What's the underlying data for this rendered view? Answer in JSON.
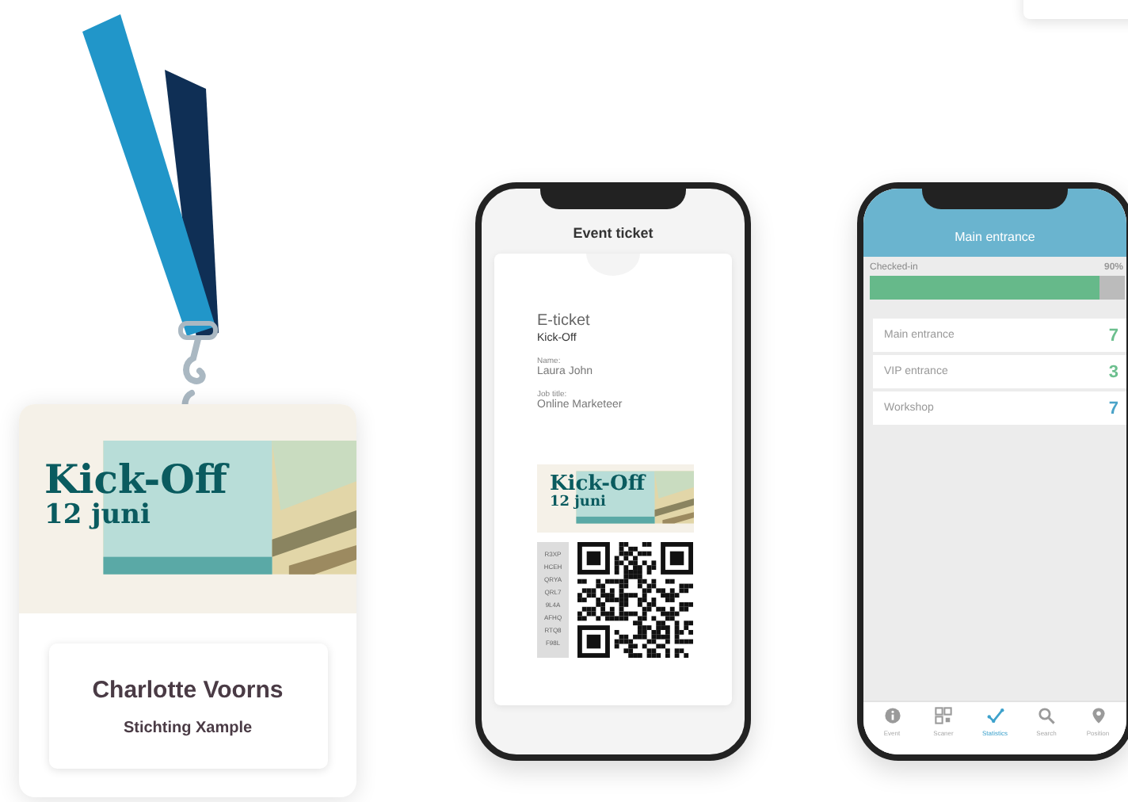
{
  "badge": {
    "banner_title": "Kick-Off",
    "banner_date": "12 juni",
    "name": "Charlotte Voorns",
    "organization": "Stichting Xample"
  },
  "ticket_phone": {
    "title": "Event ticket",
    "ticket_type": "E-ticket",
    "event": "Kick-Off",
    "fields": [
      {
        "label": "Name:",
        "value": "Laura John"
      },
      {
        "label": "Job title:",
        "value": "Online Marketeer"
      }
    ],
    "banner_title": "Kick-Off",
    "banner_date": "12 juni",
    "code_lines": [
      "R3XP",
      "HCEH",
      "QRYA",
      "QRL7",
      "9L4A",
      "AFHQ",
      "RTQ8",
      "F98L"
    ]
  },
  "stats_phone": {
    "title": "Main entrance",
    "progress": {
      "label": "Checked-in",
      "reading": "90%",
      "level": 0.9
    },
    "entrances": [
      {
        "name": "Main entrance",
        "count": "7",
        "color": "#6cbf8e"
      },
      {
        "name": "VIP entrance",
        "count": "3",
        "color": "#6cbf8e"
      },
      {
        "name": "Workshop",
        "count": "7",
        "color": "#4aa3c8"
      }
    ],
    "tabs": [
      {
        "label": "Event",
        "selected": false
      },
      {
        "label": "Scaner",
        "selected": false
      },
      {
        "label": "Statistics",
        "selected": true
      },
      {
        "label": "Search",
        "selected": false
      },
      {
        "label": "Position",
        "selected": false
      }
    ]
  }
}
